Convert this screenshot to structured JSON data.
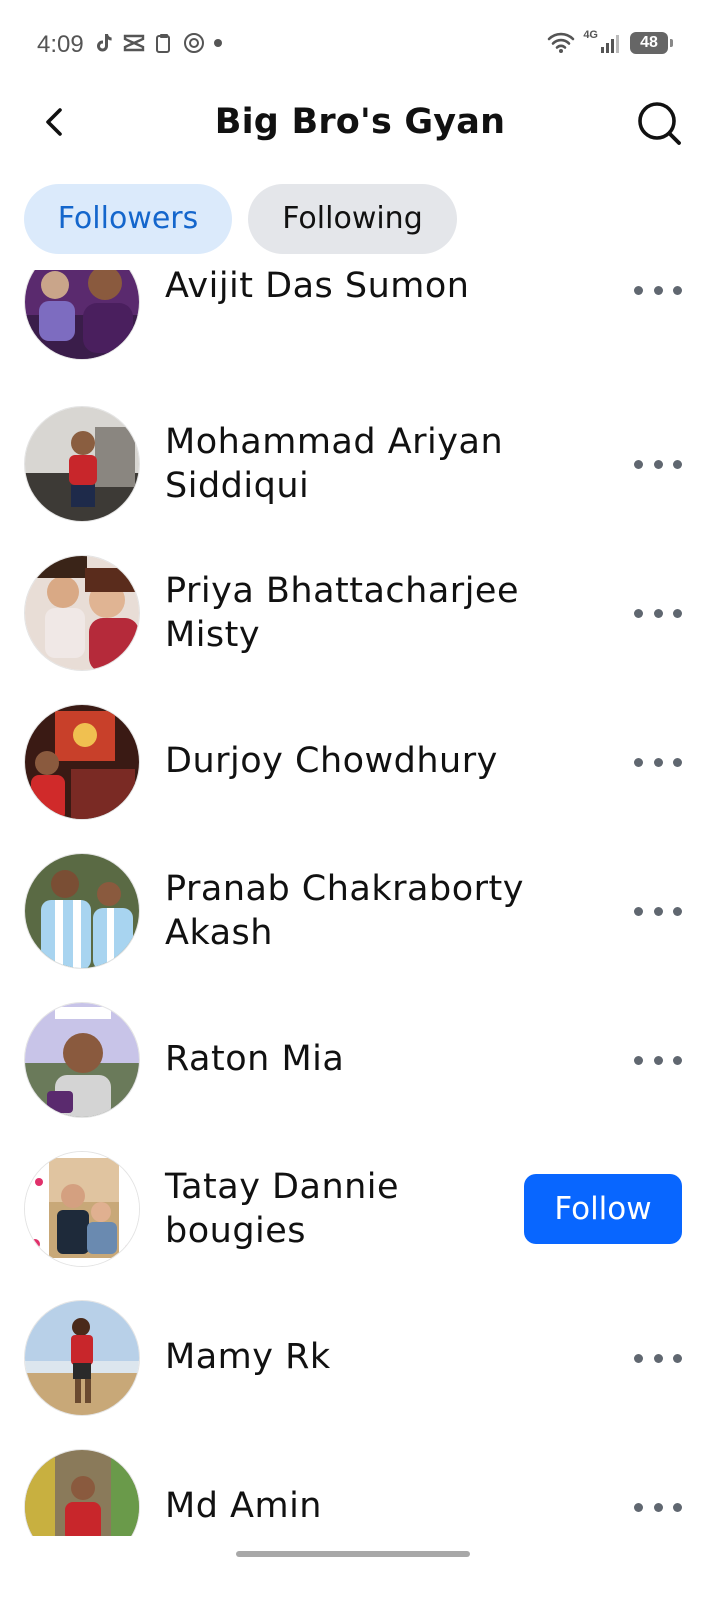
{
  "status_bar": {
    "time": "4:09",
    "network": "4G",
    "battery": "48",
    "icons": [
      "tiktok-icon",
      "capcut-icon",
      "clipboard-icon",
      "camera-app-icon",
      "wifi-icon",
      "signal-icon",
      "battery-icon"
    ]
  },
  "header": {
    "title": "Big Bro's Gyan",
    "back_icon": "chevron-left-icon",
    "search_icon": "search-icon"
  },
  "tabs": [
    {
      "label": "Followers",
      "active": true
    },
    {
      "label": "Following",
      "active": false
    }
  ],
  "followers": [
    {
      "name_lines": [
        "Avijit Das Sumon"
      ],
      "action": "more"
    },
    {
      "name_lines": [
        "Mohammad Ariyan",
        "Siddiqui"
      ],
      "action": "more"
    },
    {
      "name_lines": [
        "Priya Bhattacharjee",
        "Misty"
      ],
      "action": "more"
    },
    {
      "name_lines": [
        "Durjoy Chowdhury"
      ],
      "action": "more"
    },
    {
      "name_lines": [
        "Pranab Chakraborty",
        "Akash"
      ],
      "action": "more"
    },
    {
      "name_lines": [
        "Raton Mia"
      ],
      "action": "more"
    },
    {
      "name_lines": [
        "Tatay Dannie",
        "bougies"
      ],
      "action": "follow"
    },
    {
      "name_lines": [
        "Mamy Rk"
      ],
      "action": "more"
    },
    {
      "name_lines": [
        "Md Amin"
      ],
      "action": "more"
    }
  ],
  "follow_label": "Follow",
  "colors": {
    "accent": "#0866ff",
    "active_tab_bg": "#dbeafb",
    "active_tab_text": "#1466cc",
    "inactive_tab_bg": "#e4e6ea"
  }
}
